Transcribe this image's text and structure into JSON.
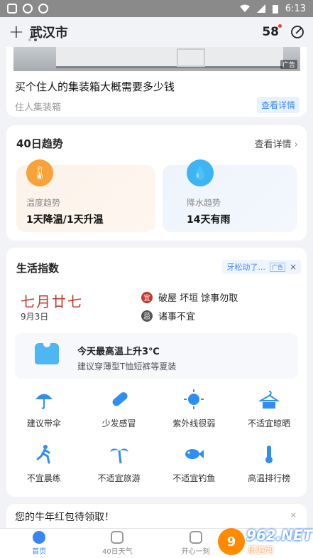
{
  "status_bar": {
    "time": "6:13"
  },
  "header": {
    "city": "武汉市",
    "plus_label": "+",
    "brand": "58"
  },
  "ad": {
    "title": "买个住人的集装箱大概需要多少钱",
    "source": "住人集装箱",
    "button": "查看详情",
    "tag": "广告"
  },
  "trend": {
    "title": "40日趋势",
    "more": "查看详情",
    "temp": {
      "label": "温度趋势",
      "value": "1天降温/1天升温"
    },
    "rain": {
      "label": "降水趋势",
      "value": "14天有雨"
    }
  },
  "life": {
    "title": "生活指数",
    "ad_text": "牙松动了...",
    "ad_tag": "广告",
    "ad_close": "×",
    "lunar": "七月廿七",
    "solar": "9月3日",
    "yi_mark": "宜",
    "yi_text": "破屋 坏垣 馀事勿取",
    "ji_mark": "忌",
    "ji_text": "诸事不宜",
    "tip_title": "今天最高温上升3℃",
    "tip_sub": "建议穿薄型T恤短裤等夏装",
    "items": [
      {
        "label": "建议带伞",
        "icon": "umbrella-icon"
      },
      {
        "label": "少发感冒",
        "icon": "pill-icon"
      },
      {
        "label": "紫外线很弱",
        "icon": "sun-icon"
      },
      {
        "label": "不适宜晾晒",
        "icon": "hanger-icon"
      },
      {
        "label": "不宜晨练",
        "icon": "runner-icon"
      },
      {
        "label": "不适宜旅游",
        "icon": "palm-tree-icon"
      },
      {
        "label": "不适宜钓鱼",
        "icon": "fish-icon"
      },
      {
        "label": "高温排行榜",
        "icon": "thermometer-icon"
      }
    ]
  },
  "promo": {
    "text": "您的牛年红包待领取！",
    "close": "×"
  },
  "tabs": [
    {
      "label": "首页",
      "active": true
    },
    {
      "label": "40日天气",
      "active": false
    },
    {
      "label": "开心一刻",
      "active": false
    }
  ],
  "watermark": {
    "num": "962.NET",
    "site": "乐游网",
    "ball": "9"
  },
  "colors": {
    "accent": "#3a86f0",
    "temp": "#f7a23a",
    "rain": "#3fb4f4",
    "lucky": "#c0392b"
  }
}
